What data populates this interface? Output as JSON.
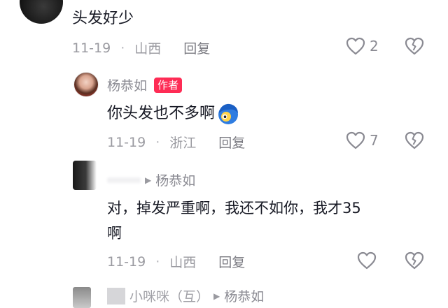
{
  "comments": [
    {
      "text": "头发好少",
      "date": "11-19",
      "location": "山西",
      "reply_label": "回复",
      "likes": "2"
    },
    {
      "username": "杨恭如",
      "author_tag": "作者",
      "text": "你头发也不多啊",
      "emoji_icon": "blue-hair-face-emoji",
      "date": "11-19",
      "location": "浙江",
      "reply_label": "回复",
      "likes": "7"
    },
    {
      "reply_to": "杨恭如",
      "text_line1": "对，掉发严重啊，我还不如你，我才35",
      "text_line2": "啊",
      "date": "11-19",
      "location": "山西",
      "reply_label": "回复"
    },
    {
      "username_partial": "小咪咪（互）",
      "reply_to": "杨恭如"
    }
  ],
  "colors": {
    "author_tag_bg": "#fe2c55",
    "meta_text": "#9a9aa0",
    "main_text": "#161823"
  }
}
